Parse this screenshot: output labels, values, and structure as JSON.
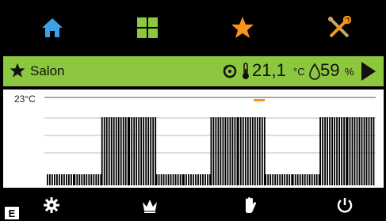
{
  "nav": {
    "items": [
      {
        "icon": "home-icon",
        "color": "#3ea0e6"
      },
      {
        "icon": "grid-icon",
        "color": "#8dc63f"
      },
      {
        "icon": "star-icon",
        "color": "#f7941d"
      },
      {
        "icon": "tools-icon",
        "color": "#f7941d"
      }
    ]
  },
  "status": {
    "room": "Salon",
    "temperature": "21,1",
    "temperature_unit": "°C",
    "humidity": "59",
    "humidity_unit": "%",
    "bar_color": "#8dc63f"
  },
  "chart": {
    "reference_label": "23°C",
    "marker_color": "#f7941d",
    "chart_data": {
      "type": "bar",
      "series": [
        {
          "values": [
            "low",
            "low",
            "high",
            "high",
            "low",
            "low",
            "high",
            "high",
            "low",
            "low",
            "high",
            "high"
          ]
        }
      ]
    }
  },
  "bottom": {
    "items": [
      "settings-icon",
      "crown-icon",
      "hand-icon",
      "power-icon"
    ]
  },
  "corner_label": "E"
}
